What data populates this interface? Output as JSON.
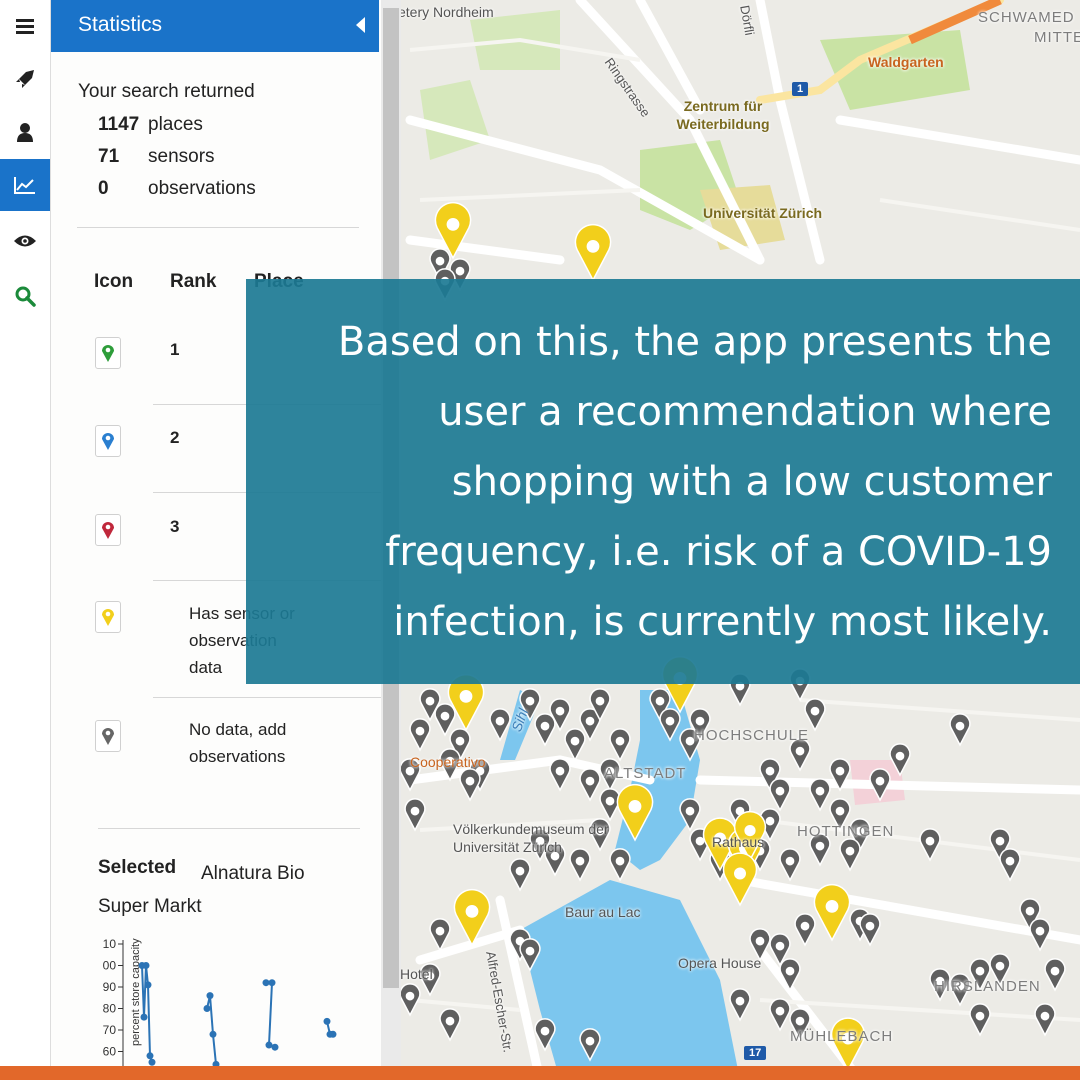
{
  "sidebar": {
    "title": "Statistics",
    "search_intro": "Your search returned",
    "counts": [
      {
        "value": "1147",
        "label": "places"
      },
      {
        "value": "71",
        "label": "sensors"
      },
      {
        "value": "0",
        "label": "observations"
      }
    ],
    "table_headers": [
      "Icon",
      "Rank",
      "Place"
    ],
    "ranks": [
      {
        "rank": "1",
        "pin_color": "#2e9d3a"
      },
      {
        "rank": "2",
        "pin_color": "#2a7fd0"
      },
      {
        "rank": "3",
        "pin_color": "#c0283c"
      }
    ],
    "legend": [
      {
        "pin_color": "#f2cf1b",
        "text": "Has sensor or observation data"
      },
      {
        "pin_color": "#666666",
        "text": "No data, add observations"
      }
    ],
    "selected_label": "Selected",
    "selected_name": "Alnatura Bio Super Markt"
  },
  "chart_data": {
    "type": "line",
    "ylabel": "percent store capacity",
    "y_ticks": [
      "10",
      "00",
      "90",
      "80",
      "70",
      "60"
    ],
    "series": [
      {
        "values": [
          100,
          76,
          100,
          91,
          58,
          55,
          80,
          86,
          68,
          54,
          92,
          92,
          63,
          62,
          74,
          68,
          68
        ]
      }
    ]
  },
  "map": {
    "labels": {
      "cemetery": "etery Nordheim",
      "street_ring": "Ringstrasse",
      "street_dorf": "Dörfli",
      "district_schwamendingen": "SCHWAMED",
      "district_mitte": "MITTE",
      "restaurant": "Waldgarten",
      "road_shield": "1",
      "zentrum": "Zentrum für Weiterbildung",
      "university": "Universität Zürich",
      "hochschule": "HOCHSCHULE",
      "cooperativo": "Cooperativo",
      "altstadt": "ALTSTADT",
      "sihl": "Sihl",
      "museum": "Völkerkundemuseum der Universität Zürich",
      "rathaus": "Rathaus",
      "hottingen": "HOTTINGEN",
      "baur": "Baur au Lac",
      "opera": "Opera House",
      "hirslanden": "HIRSLANDEN",
      "muhlebach": "MÜHLEBACH",
      "hotel": "Hotel",
      "alfred": "Alfred-Escher-Str.",
      "shield17": "17"
    },
    "accent_colors": {
      "yellow_pin": "#f2cf1b",
      "grey_pin": "#666666",
      "lake": "#7cc6ee",
      "park": "#c9e3a4"
    }
  },
  "overlay": {
    "text": "Based on this, the app presents the user a recommendation where shopping with a low customer frequency, i.e. risk of a COVID-19 infection, is currently most likely."
  },
  "icons": [
    "menu-icon",
    "rocket-icon",
    "user-icon",
    "chart-icon",
    "eye-icon",
    "search-icon"
  ],
  "theme": {
    "accent": "#1a73c9",
    "overlay": "#1c7a94",
    "bottom_bar": "#e2682a"
  }
}
